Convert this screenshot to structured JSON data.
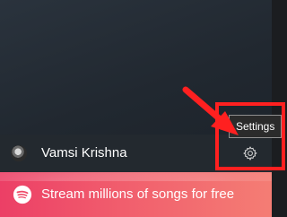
{
  "user": {
    "name": "Vamsi Krishna",
    "avatar_icon": "user-avatar-icon"
  },
  "settings": {
    "icon": "gear-icon",
    "tooltip": "Settings"
  },
  "promo": {
    "text": "Stream millions of songs for free",
    "logo_icon": "spotify-logo-icon"
  },
  "annotation": {
    "color": "#ff2020"
  },
  "colors": {
    "panel_bg": "#212830",
    "banner_start": "#ec3f66",
    "banner_end": "#f47d74"
  }
}
